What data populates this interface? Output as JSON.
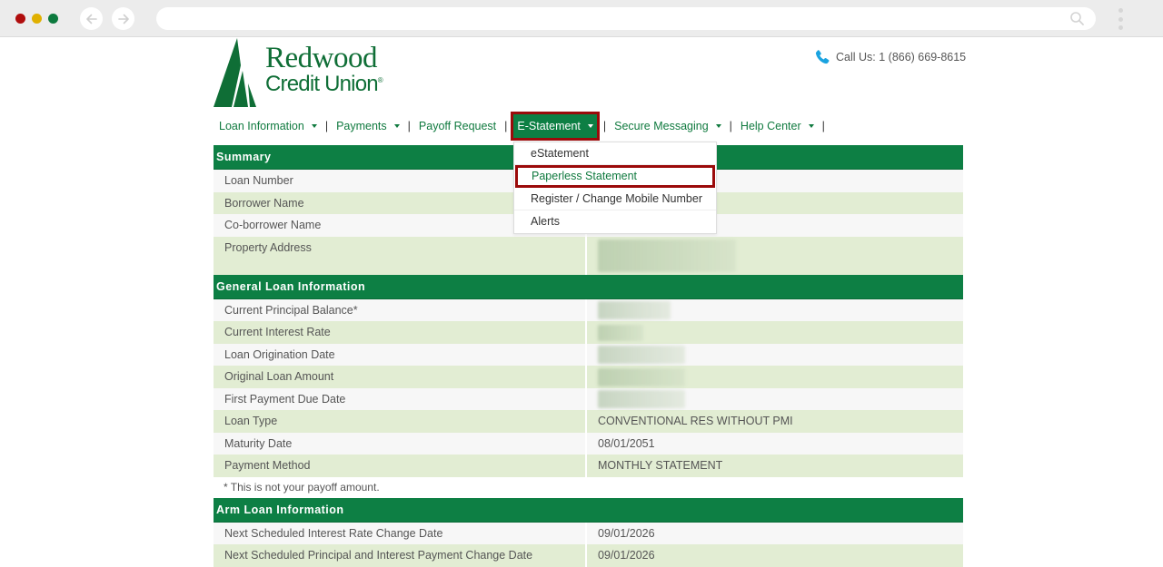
{
  "browser": {
    "url": "",
    "back_icon": "arrow-left-icon",
    "forward_icon": "arrow-right-icon",
    "search_icon": "search-icon",
    "menu_icon": "kebab-menu-icon"
  },
  "header": {
    "logo_line1": "Redwood",
    "logo_line2": "Credit Union",
    "logo_trademark": "®",
    "call_label": "Call Us: 1 (866) 669-8615",
    "phone_icon": "phone-icon"
  },
  "nav": {
    "items": [
      {
        "label": "Loan Information",
        "has_caret": true
      },
      {
        "label": "Payments",
        "has_caret": true
      },
      {
        "label": "Payoff Request",
        "has_caret": false
      },
      {
        "label": "E-Statement",
        "has_caret": true,
        "active": true
      },
      {
        "label": "Secure Messaging",
        "has_caret": true
      },
      {
        "label": "Help Center",
        "has_caret": true
      }
    ],
    "separator": "|"
  },
  "dropdown": {
    "items": [
      {
        "label": "eStatement"
      },
      {
        "label": "Paperless Statement",
        "highlighted": true
      },
      {
        "label": "Register / Change Mobile Number"
      },
      {
        "label": "Alerts"
      }
    ]
  },
  "summary": {
    "title": "Summary",
    "rows": [
      {
        "label": "Loan Number",
        "value": ""
      },
      {
        "label": "Borrower Name",
        "value": ""
      },
      {
        "label": "Co-borrower Name",
        "value": ""
      },
      {
        "label": "Property Address",
        "value": "[redacted]"
      }
    ]
  },
  "general": {
    "title": "General Loan Information",
    "rows": [
      {
        "label": "Current Principal Balance*",
        "value": "[redacted]"
      },
      {
        "label": "Current Interest Rate",
        "value": "[redacted]"
      },
      {
        "label": "Loan Origination Date",
        "value": "[redacted]"
      },
      {
        "label": "Original Loan Amount",
        "value": "[redacted]"
      },
      {
        "label": "First Payment Due Date",
        "value": "[redacted]"
      },
      {
        "label": "Loan Type",
        "value": "CONVENTIONAL RES WITHOUT PMI"
      },
      {
        "label": "Maturity Date",
        "value": "08/01/2051"
      },
      {
        "label": "Payment Method",
        "value": "MONTHLY STATEMENT"
      }
    ],
    "note": "* This is not your payoff amount."
  },
  "arm": {
    "title": "Arm Loan Information",
    "rows": [
      {
        "label": "Next Scheduled Interest Rate Change Date",
        "value": "09/01/2026"
      },
      {
        "label": "Next Scheduled Principal and Interest Payment Change Date",
        "value": "09/01/2026"
      }
    ]
  },
  "colors": {
    "brand_green": "#0d7f44",
    "highlight_border": "#9b0a0a",
    "row_alt": "#e2edd3",
    "row_plain": "#f7f7f7"
  }
}
